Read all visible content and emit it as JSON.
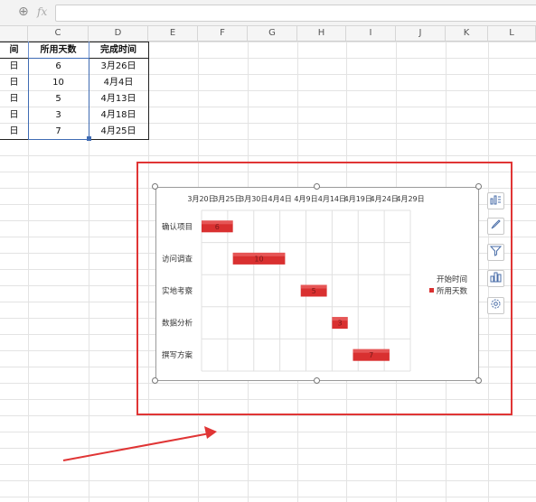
{
  "formula_bar": {
    "zoom_icon": "zoom-icon",
    "fx_label": "fx",
    "value": ""
  },
  "columns": [
    {
      "letter": "",
      "left": 0,
      "width": 0
    },
    {
      "letter": "C"
    },
    {
      "letter": "D"
    },
    {
      "letter": "E"
    },
    {
      "letter": "F"
    },
    {
      "letter": "G"
    },
    {
      "letter": "H"
    },
    {
      "letter": "I"
    },
    {
      "letter": "J"
    },
    {
      "letter": "K"
    },
    {
      "letter": "L"
    }
  ],
  "table": {
    "headers": {
      "b": "间",
      "c": "所用天数",
      "d": "完成时间"
    },
    "rows": [
      {
        "b": "日",
        "c": "6",
        "d": "3月26日"
      },
      {
        "b": "日",
        "c": "10",
        "d": "4月4日"
      },
      {
        "b": "日",
        "c": "5",
        "d": "4月13日"
      },
      {
        "b": "日",
        "c": "3",
        "d": "4月18日"
      },
      {
        "b": "日",
        "c": "7",
        "d": "4月25日"
      }
    ]
  },
  "chart_data": {
    "type": "bar",
    "orientation": "horizontal-stacked-gantt",
    "categories": [
      "确认项目",
      "访问调查",
      "实地考察",
      "数据分析",
      "撰写方案"
    ],
    "x_ticks": [
      "3月20日",
      "3月25日",
      "3月30日",
      "4月4日",
      "4月9日",
      "4月14日",
      "4月19日",
      "4月24日",
      "4月29日"
    ],
    "x_tick_offsets": [
      0,
      5,
      10,
      15,
      20,
      25,
      30,
      35,
      40
    ],
    "series": [
      {
        "name": "开始时间",
        "visible": false,
        "values": [
          0,
          6,
          19,
          25,
          29
        ]
      },
      {
        "name": "所用天数",
        "color": "#d93030",
        "values": [
          6,
          10,
          5,
          3,
          7
        ],
        "data_labels": [
          "6",
          "10",
          "5",
          "3",
          "7"
        ]
      }
    ],
    "legend_placement": "right",
    "grid": true
  },
  "side_tools": [
    "chart-elements-icon",
    "chart-style-icon",
    "chart-filter-icon",
    "chart-layout-icon",
    "chart-settings-icon"
  ]
}
